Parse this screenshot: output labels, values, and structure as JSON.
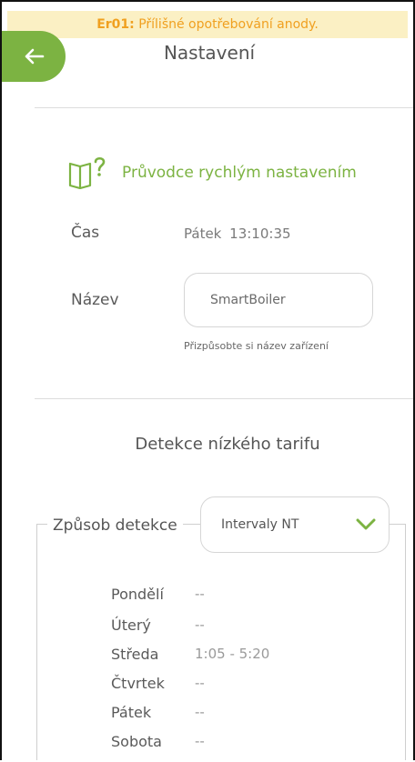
{
  "error": {
    "code": "Er01:",
    "message": "Přílišné opotřebování anody."
  },
  "header": {
    "title": "Nastavení"
  },
  "guide": {
    "label": "Průvodce rychlým nastavením"
  },
  "time": {
    "label": "Čas",
    "day": "Pátek",
    "clock": "13:10:35"
  },
  "name": {
    "label": "Název",
    "value": "SmartBoiler",
    "hint": "Přizpůsobte si název zařízení"
  },
  "tariff": {
    "title": "Detekce nízkého tarifu",
    "method_label": "Způsob detekce",
    "method_value": "Intervaly NT",
    "days": [
      {
        "name": "Pondělí",
        "time": "--"
      },
      {
        "name": "Úterý",
        "time": "--"
      },
      {
        "name": "Středa",
        "time": "1:05 - 5:20"
      },
      {
        "name": "Čtvrtek",
        "time": "--"
      },
      {
        "name": "Pátek",
        "time": "--"
      },
      {
        "name": "Sobota",
        "time": "--"
      }
    ]
  },
  "colors": {
    "accent": "#7cb342",
    "warning": "#f0a020",
    "warning_bg": "#fbf0c4"
  },
  "icons": {
    "back": "arrow-left-icon",
    "guide": "book-question-icon",
    "dropdown": "chevron-down-icon"
  }
}
